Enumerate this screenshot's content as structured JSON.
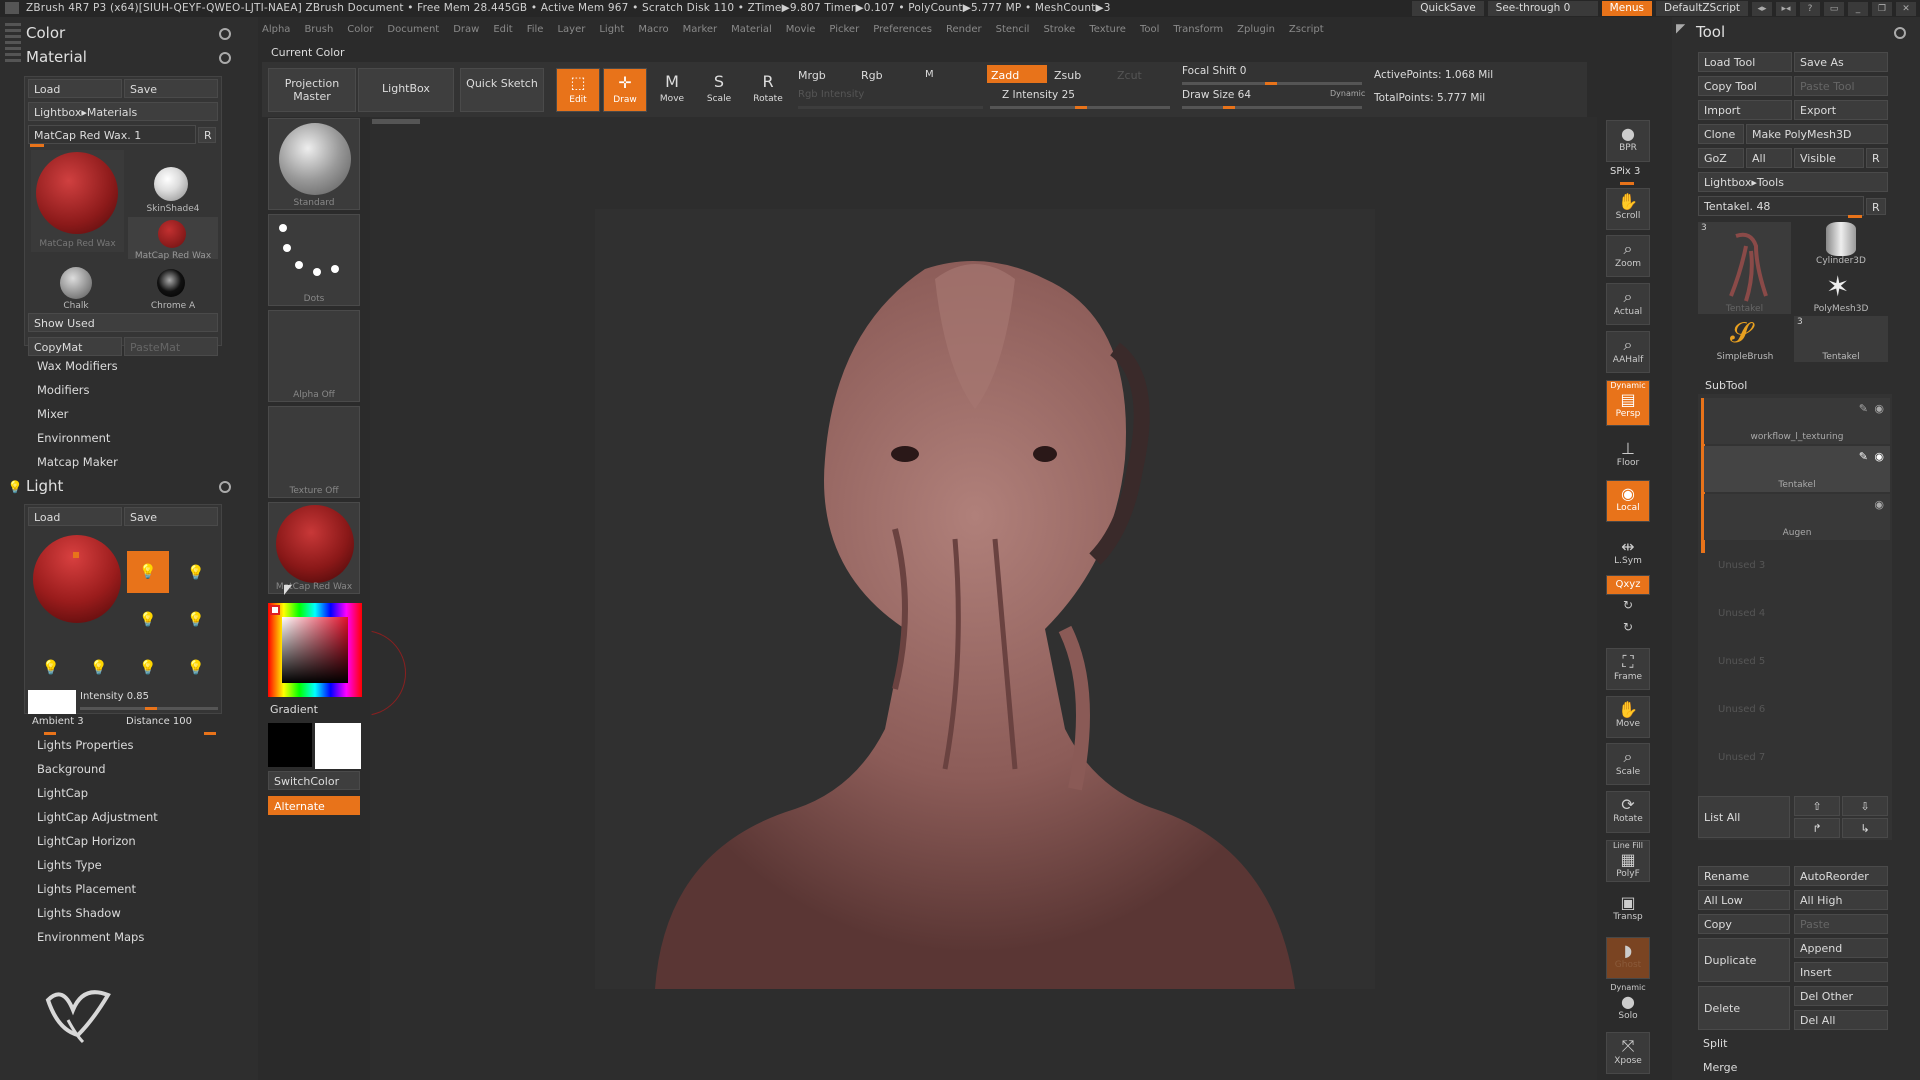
{
  "titlebar": {
    "text": "ZBrush 4R7 P3 (x64)[SIUH-QEYF-QWEO-LJTI-NAEA]   ZBrush Document    • Free Mem 28.445GB • Active Mem 967 • Scratch Disk 110 • ZTime▶9.807 Timer▶0.107 • PolyCount▶5.777 MP  • MeshCount▶3",
    "quicksave": "QuickSave",
    "seethrough": "See-through  0",
    "menus": "Menus",
    "script": "DefaultZScript"
  },
  "menubar": [
    "Alpha",
    "Brush",
    "Color",
    "Document",
    "Draw",
    "Edit",
    "File",
    "Layer",
    "Light",
    "Macro",
    "Marker",
    "Material",
    "Movie",
    "Picker",
    "Preferences",
    "Render",
    "Stencil",
    "Stroke",
    "Texture",
    "Tool",
    "Transform",
    "Zplugin",
    "Zscript"
  ],
  "left": {
    "color_title": "Color",
    "material_title": "Material",
    "load": "Load",
    "save": "Save",
    "lightbox_materials": "Lightbox▸Materials",
    "current_material": "MatCap Red Wax. 1",
    "r": "R",
    "materials": [
      {
        "name": "MatCap Red Wax"
      },
      {
        "name": "SkinShade4"
      },
      {
        "name": "MatCap Red Wax"
      },
      {
        "name": "Chalk"
      },
      {
        "name": "Chrome A"
      }
    ],
    "show_used": "Show Used",
    "copymat": "CopyMat",
    "pastemat": "PasteMat",
    "material_subs": [
      "Wax Modifiers",
      "Modifiers",
      "Mixer",
      "Environment",
      "Matcap Maker"
    ],
    "light_title": "Light",
    "intensity": "Intensity 0.85",
    "ambient": "Ambient 3",
    "distance": "Distance 100",
    "light_subs": [
      "Lights Properties",
      "Background",
      "LightCap",
      "LightCap Adjustment",
      "LightCap Horizon",
      "Lights Type",
      "Lights Placement",
      "Lights Shadow",
      "Environment Maps"
    ]
  },
  "shelf": {
    "current_color": "Current Color",
    "projection_master": "Projection Master",
    "lightbox": "LightBox",
    "quick_sketch": "Quick Sketch",
    "edit": "Edit",
    "draw": "Draw",
    "move": "Move",
    "scale": "Scale",
    "rotate": "Rotate",
    "mrgb": "Mrgb",
    "rgb": "Rgb",
    "m": "M",
    "zadd": "Zadd",
    "zsub": "Zsub",
    "zcut": "Zcut",
    "rgb_intensity": "Rgb Intensity",
    "z_intensity": "Z Intensity 25",
    "focal_shift": "Focal Shift 0",
    "draw_size": "Draw Size 64",
    "dynamic": "Dynamic",
    "active_points": "ActivePoints: 1.068 Mil",
    "total_points": "TotalPoints: 5.777 Mil"
  },
  "leftshelf": {
    "standard": "Standard",
    "dots": "Dots",
    "alpha_off": "Alpha  Off",
    "texture_off": "Texture  Off",
    "matcap": "MatCap Red Wax",
    "gradient": "Gradient",
    "switchcolor": "SwitchColor",
    "alternate": "Alternate"
  },
  "righttools": [
    {
      "name": "bpr",
      "label": "BPR"
    },
    {
      "name": "spix",
      "label": "SPix 3"
    },
    {
      "name": "scroll",
      "label": "Scroll"
    },
    {
      "name": "zoom",
      "label": "Zoom"
    },
    {
      "name": "actual",
      "label": "Actual"
    },
    {
      "name": "aahalf",
      "label": "AAHalf"
    },
    {
      "name": "persp",
      "label": "Persp"
    },
    {
      "name": "floor",
      "label": "Floor"
    },
    {
      "name": "local",
      "label": "Local"
    },
    {
      "name": "lsym",
      "label": "L.Sym"
    },
    {
      "name": "xyz",
      "label": "Qxyz"
    },
    {
      "name": "frame",
      "label": "Frame"
    },
    {
      "name": "move",
      "label": "Move"
    },
    {
      "name": "scale",
      "label": "Scale"
    },
    {
      "name": "rotate",
      "label": "Rotate"
    },
    {
      "name": "polyf",
      "label": "PolyF"
    },
    {
      "name": "transp",
      "label": "Transp"
    },
    {
      "name": "ghost",
      "label": "Ghost"
    },
    {
      "name": "solo",
      "label": "Solo"
    },
    {
      "name": "xpose",
      "label": "Xpose"
    }
  ],
  "righttool_extras": {
    "dynamic": "Dynamic",
    "linefill": "Line Fill"
  },
  "tool": {
    "title": "Tool",
    "load_tool": "Load Tool",
    "save_as": "Save As",
    "copy_tool": "Copy Tool",
    "paste_tool": "Paste Tool",
    "import": "Import",
    "export": "Export",
    "clone": "Clone",
    "make_polymesh": "Make PolyMesh3D",
    "goz": "GoZ",
    "all": "All",
    "visible": "Visible",
    "r": "R",
    "lightbox_tools": "Lightbox▸Tools",
    "tentakel_slider": "Tentakel. 48",
    "thumbs": [
      {
        "name": "Tentakel",
        "count": "3"
      },
      {
        "name": "Cylinder3D"
      },
      {
        "name": "PolyMesh3D"
      },
      {
        "name": "SimpleBrush"
      },
      {
        "name": "Tentakel",
        "count": "3"
      }
    ],
    "subtool_title": "SubTool",
    "subtools": [
      "workflow_l_texturing",
      "Tentakel",
      "Augen"
    ],
    "unused": [
      "Unused 3",
      "Unused 4",
      "Unused 5",
      "Unused 6",
      "Unused 7"
    ],
    "list_all": "List  All",
    "rename": "Rename",
    "autoreorder": "AutoReorder",
    "all_low": "All Low",
    "all_high": "All High",
    "copy": "Copy",
    "paste": "Paste",
    "duplicate": "Duplicate",
    "append": "Append",
    "insert": "Insert",
    "delete": "Delete",
    "del_other": "Del Other",
    "del_all": "Del All",
    "split": "Split",
    "merge": "Merge"
  },
  "colors": {
    "accent": "#e8731a",
    "bg": "#2b2b2b",
    "panel": "#353535"
  }
}
